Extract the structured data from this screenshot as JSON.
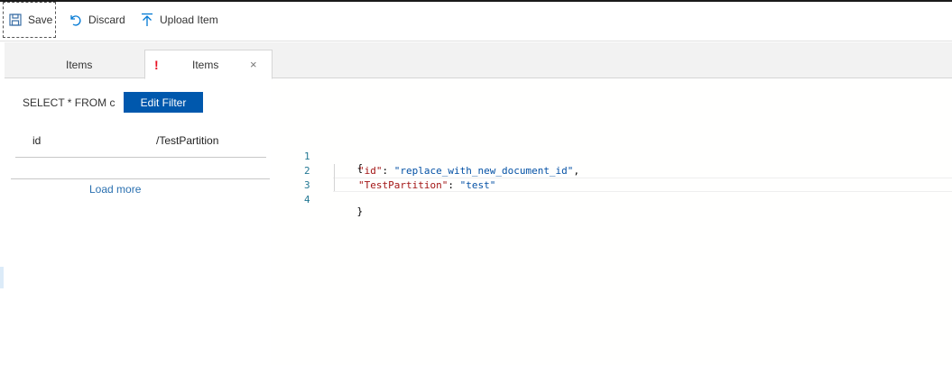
{
  "toolbar": {
    "save_label": "Save",
    "discard_label": "Discard",
    "upload_label": "Upload Item"
  },
  "tabs": [
    {
      "label": "Items"
    },
    {
      "label": "Items",
      "warning": "!",
      "close": "×"
    }
  ],
  "left_pane": {
    "query": "SELECT * FROM c",
    "edit_filter_label": "Edit Filter",
    "columns": [
      "id",
      "/TestPartition"
    ],
    "load_more_label": "Load more"
  },
  "editor": {
    "line_numbers": [
      "1",
      "2",
      "3",
      "4"
    ],
    "open_brace": "{",
    "line2_key": "\"id\"",
    "line2_sep": ": ",
    "line2_value": "\"replace_with_new_document_id\"",
    "line2_comma": ",",
    "line3_key": "\"TestPartition\"",
    "line3_sep": ": ",
    "line3_value": "\"test\"",
    "close_brace": "}"
  },
  "colors": {
    "accent": "#0058ad",
    "warning": "#e81123",
    "json_key": "#a31515",
    "json_string": "#0451a5",
    "line_number": "#237893"
  }
}
